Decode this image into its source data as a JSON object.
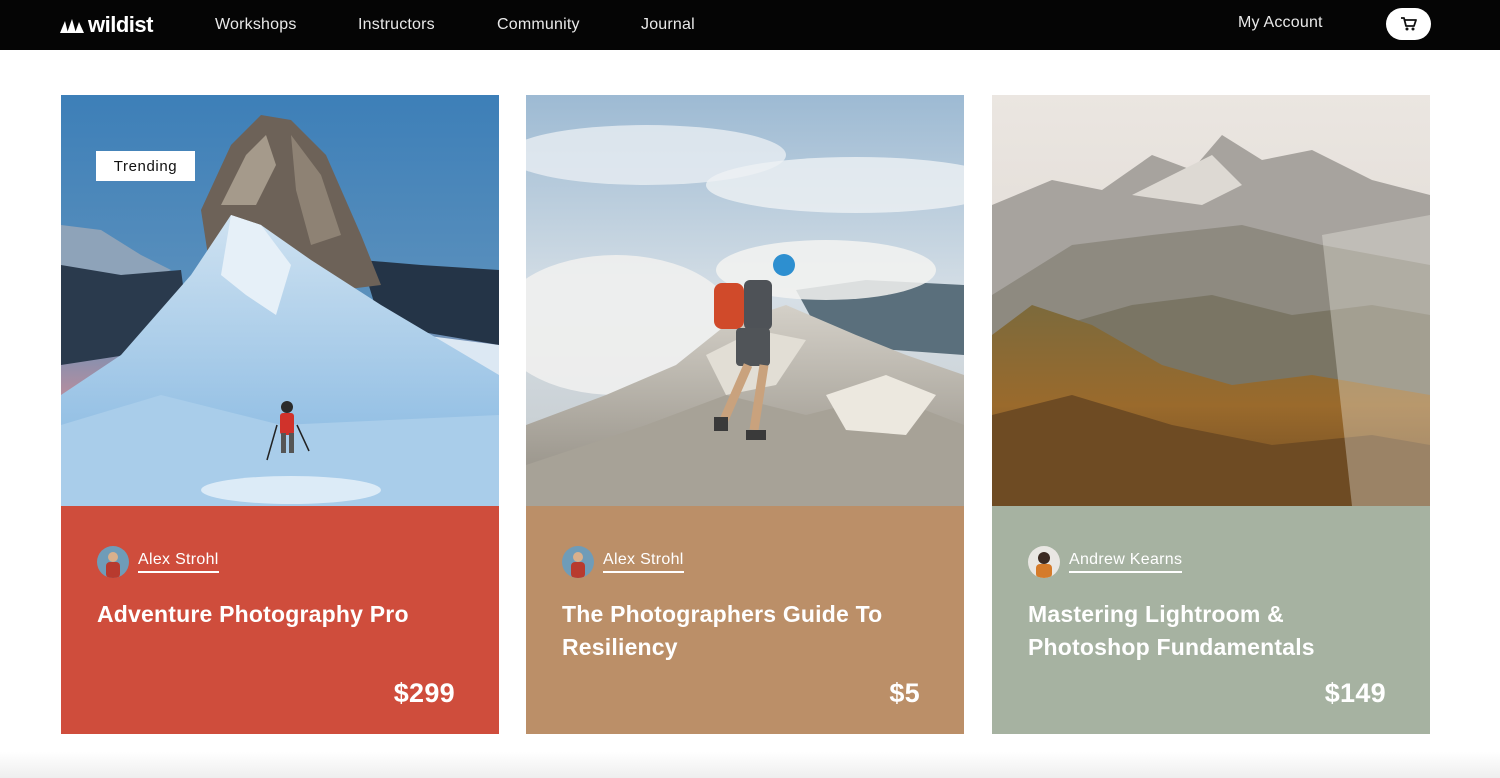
{
  "nav": {
    "logo": "wildist",
    "links": [
      "Workshops",
      "Instructors",
      "Community",
      "Journal"
    ],
    "account": "My Account",
    "cart_icon": "cart-icon"
  },
  "cards": [
    {
      "badge": "Trending",
      "author": "Alex Strohl",
      "title": "Adventure Photography Pro",
      "price": "$299",
      "color": "#cf4d3c",
      "image": "snowy-mountain-hiker"
    },
    {
      "author": "Alex Strohl",
      "title": "The Photographers Guide To Resiliency",
      "price": "$5",
      "color": "#bb8f68",
      "image": "rocky-ridge-hiker"
    },
    {
      "author": "Andrew Kearns",
      "title": "Mastering Lightroom & Photoshop Fundamentals",
      "price": "$149",
      "color": "#a6b2a1",
      "image": "misty-forest-valley"
    }
  ]
}
